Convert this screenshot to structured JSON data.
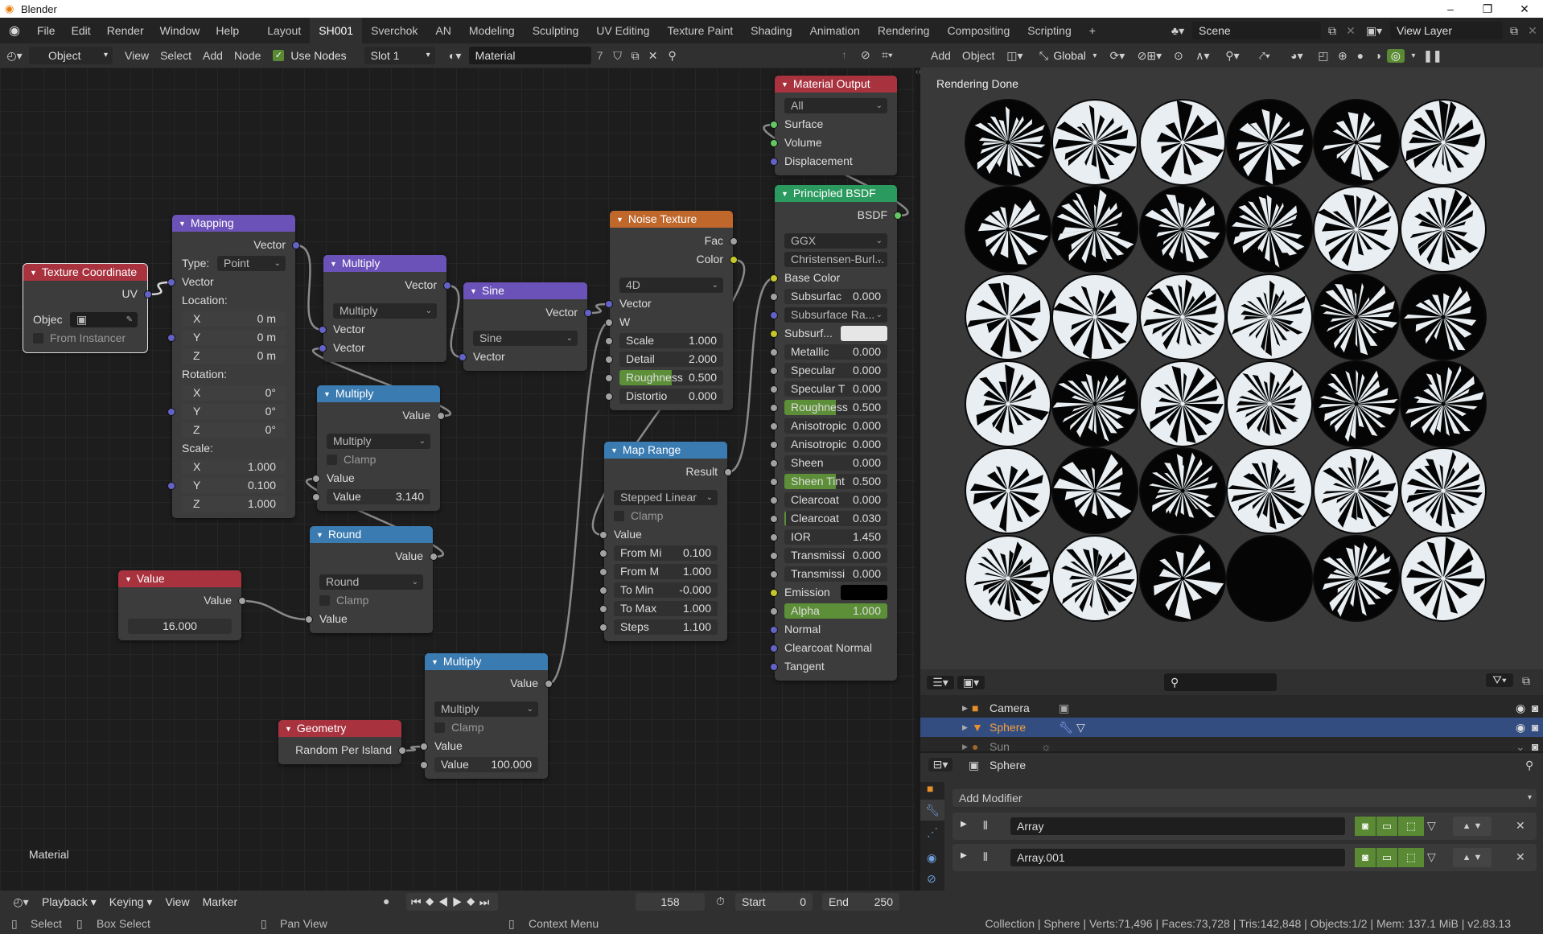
{
  "window": {
    "title": "Blender",
    "controls": [
      "–",
      "❐",
      "✕"
    ]
  },
  "topbar": {
    "menus": [
      "File",
      "Edit",
      "Render",
      "Window",
      "Help"
    ],
    "workspaces": [
      "Layout",
      "SH001",
      "Sverchok",
      "AN",
      "Modeling",
      "Sculpting",
      "UV Editing",
      "Texture Paint",
      "Shading",
      "Animation",
      "Rendering",
      "Compositing",
      "Scripting"
    ],
    "active_workspace": "SH001",
    "add_tab": "+",
    "scene": "Scene",
    "view_layer": "View Layer"
  },
  "node_header": {
    "mode": "Object",
    "menus": [
      "View",
      "Select",
      "Add",
      "Node"
    ],
    "use_nodes_label": "Use Nodes",
    "use_nodes": true,
    "slot": "Slot 1",
    "material": "Material",
    "users": "7"
  },
  "viewport_header": {
    "menus": [
      "Add",
      "Object"
    ],
    "orientation": "Global"
  },
  "editor": {
    "label": "Material"
  },
  "socket_colors": {
    "vector": "#6363c7",
    "float": "#a1a1a1",
    "color": "#c7c729",
    "shader": "#63c763"
  },
  "nodes": [
    {
      "id": "texcoord",
      "title": "Texture Coordinate",
      "color": "#a8323e",
      "selected": true,
      "rows": [
        {
          "t": "out",
          "label": "UV",
          "sock": "vector",
          "key": "uv"
        },
        {
          "t": "gap"
        },
        {
          "t": "obj",
          "label": "Objec"
        },
        {
          "t": "check",
          "label": "From Instancer"
        }
      ]
    },
    {
      "id": "mapping",
      "title": "Mapping",
      "color": "#6a52b8",
      "rows": [
        {
          "t": "out",
          "label": "Vector",
          "sock": "vector",
          "key": "out"
        },
        {
          "t": "labsel",
          "label": "Type:",
          "value": "Point"
        },
        {
          "t": "in",
          "label": "Vector",
          "sock": "vector",
          "key": "in"
        },
        {
          "t": "head",
          "label": "Location:"
        },
        {
          "t": "axis",
          "label": "X",
          "value": "0 m"
        },
        {
          "t": "axis",
          "label": "Y",
          "value": "0 m",
          "sock": "vector"
        },
        {
          "t": "axis",
          "label": "Z",
          "value": "0 m"
        },
        {
          "t": "head",
          "label": "Rotation:"
        },
        {
          "t": "axis",
          "label": "X",
          "value": "0°"
        },
        {
          "t": "axis",
          "label": "Y",
          "value": "0°",
          "sock": "vector"
        },
        {
          "t": "axis",
          "label": "Z",
          "value": "0°"
        },
        {
          "t": "head",
          "label": "Scale:"
        },
        {
          "t": "axis",
          "label": "X",
          "value": "1.000"
        },
        {
          "t": "axis",
          "label": "Y",
          "value": "0.100",
          "sock": "vector"
        },
        {
          "t": "axis",
          "label": "Z",
          "value": "1.000"
        }
      ]
    },
    {
      "id": "mult1",
      "title": "Multiply",
      "color": "#6a52b8",
      "rows": [
        {
          "t": "out",
          "label": "Vector",
          "sock": "vector",
          "key": "out"
        },
        {
          "t": "gap"
        },
        {
          "t": "select",
          "value": "Multiply"
        },
        {
          "t": "in",
          "label": "Vector",
          "sock": "vector",
          "key": "a"
        },
        {
          "t": "in",
          "label": "Vector",
          "sock": "vector",
          "key": "b"
        }
      ]
    },
    {
      "id": "sine",
      "title": "Sine",
      "color": "#6a52b8",
      "rows": [
        {
          "t": "out",
          "label": "Vector",
          "sock": "vector",
          "key": "out"
        },
        {
          "t": "gap"
        },
        {
          "t": "select",
          "value": "Sine"
        },
        {
          "t": "in",
          "label": "Vector",
          "sock": "vector",
          "key": "in"
        }
      ]
    },
    {
      "id": "mult2",
      "title": "Multiply",
      "color": "#3a7bb2",
      "rows": [
        {
          "t": "out",
          "label": "Value",
          "sock": "float",
          "key": "out"
        },
        {
          "t": "gap"
        },
        {
          "t": "select",
          "value": "Multiply"
        },
        {
          "t": "check",
          "label": "Clamp"
        },
        {
          "t": "in",
          "label": "Value",
          "sock": "float",
          "key": "a"
        },
        {
          "t": "field",
          "label": "Value",
          "value": "3.140",
          "sock": "float"
        }
      ]
    },
    {
      "id": "round",
      "title": "Round",
      "color": "#3a7bb2",
      "rows": [
        {
          "t": "out",
          "label": "Value",
          "sock": "float",
          "key": "out"
        },
        {
          "t": "gap"
        },
        {
          "t": "select",
          "value": "Round"
        },
        {
          "t": "check",
          "label": "Clamp"
        },
        {
          "t": "in",
          "label": "Value",
          "sock": "float",
          "key": "in"
        }
      ]
    },
    {
      "id": "value",
      "title": "Value",
      "color": "#a8323e",
      "rows": [
        {
          "t": "out",
          "label": "Value",
          "sock": "float",
          "key": "out"
        },
        {
          "t": "gap"
        },
        {
          "t": "num",
          "value": "16.000"
        }
      ]
    },
    {
      "id": "mult3",
      "title": "Multiply",
      "color": "#3a7bb2",
      "rows": [
        {
          "t": "out",
          "label": "Value",
          "sock": "float",
          "key": "out"
        },
        {
          "t": "gap"
        },
        {
          "t": "select",
          "value": "Multiply"
        },
        {
          "t": "check",
          "label": "Clamp"
        },
        {
          "t": "in",
          "label": "Value",
          "sock": "float",
          "key": "a"
        },
        {
          "t": "field",
          "label": "Value",
          "value": "100.000",
          "sock": "float"
        }
      ]
    },
    {
      "id": "geometry",
      "title": "Geometry",
      "color": "#a8323e",
      "rows": [
        {
          "t": "out",
          "label": "Random Per Island",
          "sock": "float",
          "key": "rpi"
        }
      ]
    },
    {
      "id": "noise",
      "title": "Noise Texture",
      "color": "#c0682c",
      "rows": [
        {
          "t": "out",
          "label": "Fac",
          "sock": "float",
          "key": "fac"
        },
        {
          "t": "out",
          "label": "Color",
          "sock": "color",
          "key": "color"
        },
        {
          "t": "gap"
        },
        {
          "t": "select",
          "value": "4D"
        },
        {
          "t": "in",
          "label": "Vector",
          "sock": "vector",
          "key": "vec"
        },
        {
          "t": "in",
          "label": "W",
          "sock": "float",
          "key": "w"
        },
        {
          "t": "field",
          "label": "Scale",
          "value": "1.000",
          "sock": "float"
        },
        {
          "t": "field",
          "label": "Detail",
          "value": "2.000",
          "sock": "float"
        },
        {
          "t": "field",
          "label": "Roughness",
          "value": "0.500",
          "fill": 0.5,
          "sock": "float"
        },
        {
          "t": "field",
          "label": "Distortio",
          "value": "0.000",
          "sock": "float"
        }
      ]
    },
    {
      "id": "maprange",
      "title": "Map Range",
      "color": "#3a7bb2",
      "rows": [
        {
          "t": "out",
          "label": "Result",
          "sock": "float",
          "key": "result"
        },
        {
          "t": "gap"
        },
        {
          "t": "select",
          "value": "Stepped Linear"
        },
        {
          "t": "check",
          "label": "Clamp"
        },
        {
          "t": "in",
          "label": "Value",
          "sock": "float",
          "key": "value"
        },
        {
          "t": "field",
          "label": "From Mi",
          "value": "0.100",
          "sock": "float"
        },
        {
          "t": "field",
          "label": "From M",
          "value": "1.000",
          "sock": "float"
        },
        {
          "t": "field",
          "label": "To Min",
          "value": "-0.000",
          "sock": "float"
        },
        {
          "t": "field",
          "label": "To Max",
          "value": "1.000",
          "sock": "float"
        },
        {
          "t": "field",
          "label": "Steps",
          "value": "1.100",
          "sock": "float"
        }
      ]
    },
    {
      "id": "matout",
      "title": "Material Output",
      "color": "#a8323e",
      "rows": [
        {
          "t": "select",
          "value": "All"
        },
        {
          "t": "in",
          "label": "Surface",
          "sock": "shader",
          "key": "surface"
        },
        {
          "t": "in",
          "label": "Volume",
          "sock": "shader",
          "key": "volume"
        },
        {
          "t": "in",
          "label": "Displacement",
          "sock": "vector",
          "key": "disp"
        }
      ]
    },
    {
      "id": "bsdf",
      "title": "Principled BSDF",
      "color": "#2b9a5e",
      "rows": [
        {
          "t": "out",
          "label": "BSDF",
          "sock": "shader",
          "key": "bsdf"
        },
        {
          "t": "gap"
        },
        {
          "t": "select",
          "value": "GGX"
        },
        {
          "t": "select",
          "value": "Christensen-Burl..."
        },
        {
          "t": "in",
          "label": "Base Color",
          "sock": "color",
          "key": "base"
        },
        {
          "t": "field",
          "label": "Subsurfac",
          "value": "0.000",
          "sock": "float"
        },
        {
          "t": "select",
          "value": "Subsurface Ra...",
          "sock": "vector"
        },
        {
          "t": "color",
          "label": "Subsurf...",
          "swatch": "#e6e6e6",
          "sock": "color"
        },
        {
          "t": "field",
          "label": "Metallic",
          "value": "0.000",
          "sock": "float"
        },
        {
          "t": "field",
          "label": "Specular",
          "value": "0.000",
          "sock": "float"
        },
        {
          "t": "field",
          "label": "Specular T",
          "value": "0.000",
          "sock": "float"
        },
        {
          "t": "field",
          "label": "Roughness",
          "value": "0.500",
          "fill": 0.5,
          "sock": "float"
        },
        {
          "t": "field",
          "label": "Anisotropic",
          "value": "0.000",
          "sock": "float"
        },
        {
          "t": "field",
          "label": "Anisotropic",
          "value": "0.000",
          "sock": "float"
        },
        {
          "t": "field",
          "label": "Sheen",
          "value": "0.000",
          "sock": "float"
        },
        {
          "t": "field",
          "label": "Sheen Tint",
          "value": "0.500",
          "fill": 0.5,
          "sock": "float"
        },
        {
          "t": "field",
          "label": "Clearcoat",
          "value": "0.000",
          "sock": "float"
        },
        {
          "t": "field",
          "label": "Clearcoat",
          "value": "0.030",
          "fill": 0.03,
          "sock": "float"
        },
        {
          "t": "field",
          "label": "IOR",
          "value": "1.450",
          "sock": "float"
        },
        {
          "t": "field",
          "label": "Transmissi",
          "value": "0.000",
          "sock": "float"
        },
        {
          "t": "field",
          "label": "Transmissi",
          "value": "0.000",
          "sock": "float"
        },
        {
          "t": "color",
          "label": "Emission",
          "swatch": "#000000",
          "sock": "color"
        },
        {
          "t": "field",
          "label": "Alpha",
          "value": "1.000",
          "fill": 1.0,
          "sock": "float"
        },
        {
          "t": "in",
          "label": "Normal",
          "sock": "vector",
          "key": "n"
        },
        {
          "t": "in",
          "label": "Clearcoat Normal",
          "sock": "vector",
          "key": "cn"
        },
        {
          "t": "in",
          "label": "Tangent",
          "sock": "vector",
          "key": "tan"
        }
      ]
    }
  ],
  "links": [
    [
      "texcoord.uv",
      "mapping.in"
    ],
    [
      "mapping.out",
      "mult1.a"
    ],
    [
      "mult2.out",
      "mult1.b"
    ],
    [
      "mult1.out",
      "sine.in"
    ],
    [
      "sine.out",
      "noise.vec"
    ],
    [
      "round.out",
      "mult2.a"
    ],
    [
      "value.out",
      "round.in"
    ],
    [
      "geometry.rpi",
      "mult3.a"
    ],
    [
      "mult3.out",
      "noise.w"
    ],
    [
      "noise.color",
      "maprange.value"
    ],
    [
      "maprange.result",
      "bsdf.base"
    ],
    [
      "bsdf.bsdf",
      "matout.surface"
    ]
  ],
  "render": {
    "status": "Rendering Done"
  },
  "outliner": {
    "items": [
      {
        "name": "Camera",
        "selected": false
      },
      {
        "name": "Sphere",
        "selected": true
      },
      {
        "name": "Sun",
        "selected": false
      }
    ]
  },
  "properties": {
    "object": "Sphere",
    "add_modifier": "Add Modifier",
    "modifiers": [
      "Array",
      "Array.001"
    ]
  },
  "timeline": {
    "menus": [
      "Playback",
      "Keying",
      "View",
      "Marker"
    ],
    "current_frame": "158",
    "start_label": "Start",
    "start": "0",
    "end_label": "End",
    "end": "250"
  },
  "statusbar": {
    "hints": [
      "Select",
      "Box Select",
      "Pan View",
      "Context Menu"
    ],
    "stats": "Collection | Sphere | Verts:71,496 | Faces:73,728 | Tris:142,848 | Objects:1/2 | Mem: 137.1 MiB | v2.83.13"
  }
}
